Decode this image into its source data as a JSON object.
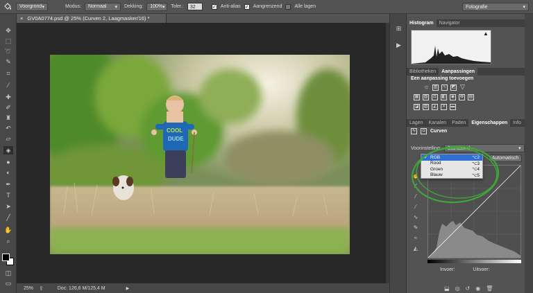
{
  "options_bar": {
    "tool_icon": "paint-bucket-icon",
    "fill_source": "Voorgrond",
    "mode_label": "Modus:",
    "mode_value": "Normaal",
    "opacity_label": "Dekking:",
    "opacity_value": "100%",
    "tolerance_label": "Toler.:",
    "tolerance_value": "32",
    "antialias_label": "Anti-alias",
    "contiguous_label": "Aangrenzend",
    "all_layers_label": "Alle lagen",
    "workspace": "Fotografie"
  },
  "document": {
    "tab_title": "GV0A0774.psd @ 25% (Curven 2, Laagmasker/16) *",
    "close_glyph": "×"
  },
  "status": {
    "zoom": "25%",
    "doc_info": "Doc: 126,6 M/125,4 M"
  },
  "panels": {
    "top_tabs": [
      "Histogram",
      "Navigator"
    ],
    "mid_tabs": [
      "Bibliotheken",
      "Aanpassingen"
    ],
    "adjustments_title": "Een aanpassing toevoegen",
    "lower_tabs": [
      "Lagen",
      "Kanalen",
      "Paden",
      "Eigenschappen",
      "Info"
    ],
    "properties_title": "Curven",
    "preset_label": "Voorinstelling:",
    "preset_value": "Standaard",
    "auto_button": "Automatisch",
    "channel_options": [
      {
        "label": "RGB",
        "shortcut": "⌥2",
        "selected": true
      },
      {
        "label": "Rood",
        "shortcut": "⌥3",
        "selected": false
      },
      {
        "label": "Groen",
        "shortcut": "⌥4",
        "selected": false
      },
      {
        "label": "Blauw",
        "shortcut": "⌥5",
        "selected": false
      }
    ],
    "input_label": "Invoer:",
    "output_label": "Uitvoer:"
  },
  "colors": {
    "highlight_circle": "#3fa63a",
    "selection": "#2f6fd1"
  }
}
